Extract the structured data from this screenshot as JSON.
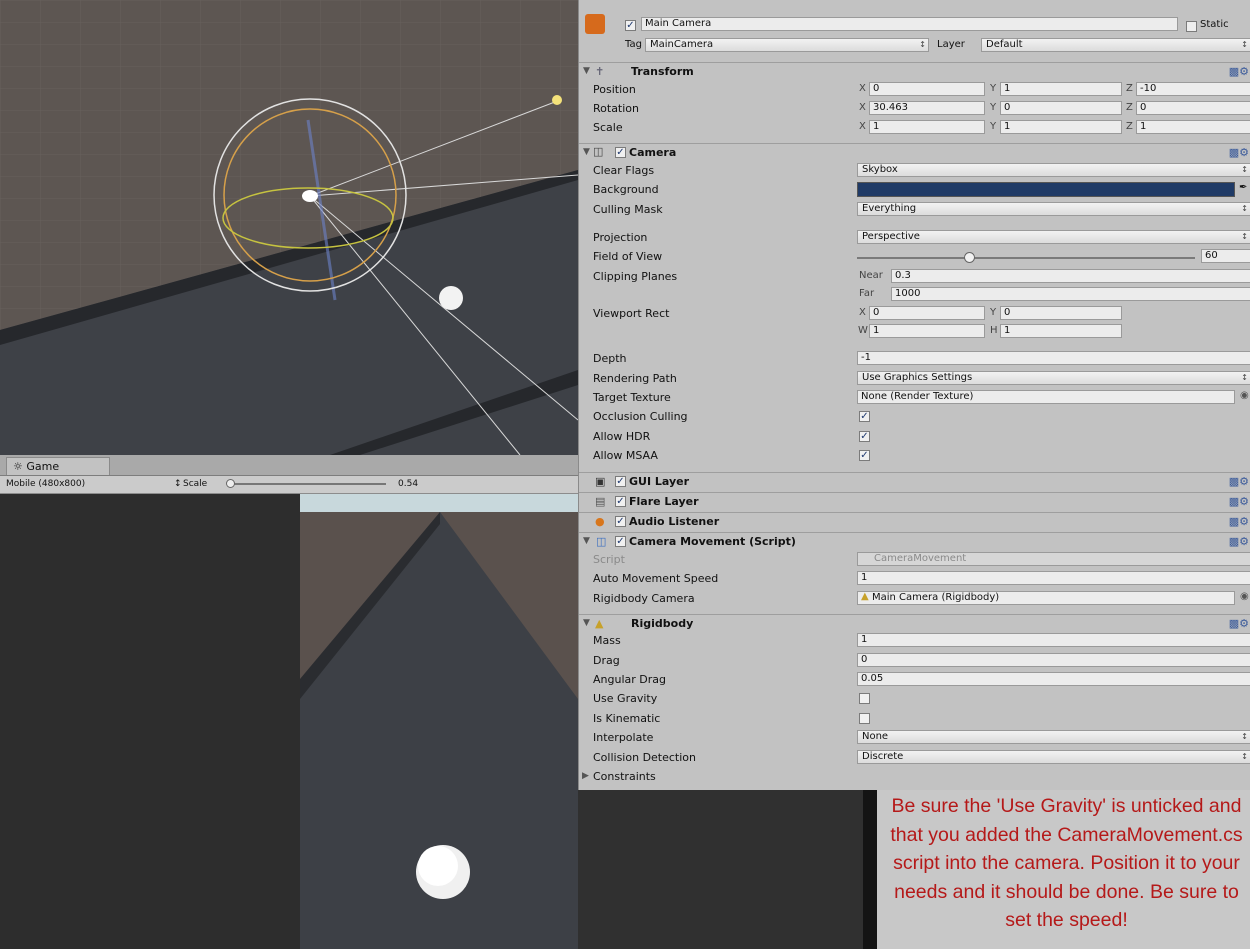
{
  "scene_view": {},
  "game_view": {
    "tab_label": "Game",
    "resolution": "Mobile (480x800)",
    "scale_label": "Scale",
    "scale_value": "0.54"
  },
  "inspector": {
    "object_name": "Main Camera",
    "static_label": "Static",
    "tag_label": "Tag",
    "tag_value": "MainCamera",
    "layer_label": "Layer",
    "layer_value": "Default",
    "transform": {
      "title": "Transform",
      "position_label": "Position",
      "rotation_label": "Rotation",
      "scale_label": "Scale",
      "axis_x": "X",
      "axis_y": "Y",
      "axis_z": "Z",
      "pos_x": "0",
      "pos_y": "1",
      "pos_z": "-10",
      "rot_x": "30.463",
      "rot_y": "0",
      "rot_z": "0",
      "scl_x": "1",
      "scl_y": "1",
      "scl_z": "1"
    },
    "camera": {
      "title": "Camera",
      "clear_flags_label": "Clear Flags",
      "clear_flags": "Skybox",
      "background_label": "Background",
      "background_color": "#1f3a66",
      "culling_mask_label": "Culling Mask",
      "culling_mask": "Everything",
      "projection_label": "Projection",
      "projection": "Perspective",
      "fov_label": "Field of View",
      "fov": "60",
      "fov_fraction": 0.33,
      "clipping_label": "Clipping Planes",
      "near_label": "Near",
      "near": "0.3",
      "far_label": "Far",
      "far": "1000",
      "viewport_label": "Viewport Rect",
      "vx_label": "X",
      "vx": "0",
      "vy_label": "Y",
      "vy": "0",
      "vw_label": "W",
      "vw": "1",
      "vh_label": "H",
      "vh": "1",
      "depth_label": "Depth",
      "depth": "-1",
      "rendering_path_label": "Rendering Path",
      "rendering_path": "Use Graphics Settings",
      "target_texture_label": "Target Texture",
      "target_texture": "None (Render Texture)",
      "occlusion_label": "Occlusion Culling",
      "hdr_label": "Allow HDR",
      "msaa_label": "Allow MSAA"
    },
    "gui_layer": {
      "title": "GUI Layer"
    },
    "flare_layer": {
      "title": "Flare Layer"
    },
    "audio_listener": {
      "title": "Audio Listener"
    },
    "camera_movement": {
      "title": "Camera Movement (Script)",
      "script_label": "Script",
      "script_value": "CameraMovement",
      "speed_label": "Auto Movement Speed",
      "speed_value": "1",
      "rb_label": "Rigidbody Camera",
      "rb_value": "Main Camera (Rigidbody)"
    },
    "rigidbody": {
      "title": "Rigidbody",
      "mass_label": "Mass",
      "mass": "1",
      "drag_label": "Drag",
      "drag": "0",
      "angular_label": "Angular Drag",
      "angular": "0.05",
      "gravity_label": "Use Gravity",
      "kinematic_label": "Is Kinematic",
      "interpolate_label": "Interpolate",
      "interpolate": "None",
      "collision_label": "Collision Detection",
      "collision": "Discrete",
      "constraints_label": "Constraints"
    }
  },
  "note": {
    "text": "Be sure the 'Use Gravity' is unticked and that you added the CameraMovement.cs script into the camera. Position it to your needs and it should be done. Be sure to set the speed!",
    "color": "#b51919"
  }
}
